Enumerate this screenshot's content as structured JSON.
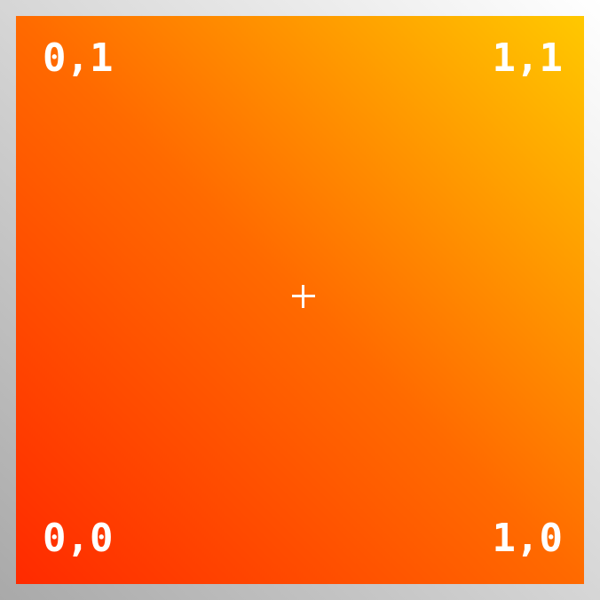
{
  "corners": {
    "top_left": "0,1",
    "top_right": "1,1",
    "bottom_left": "0,0",
    "bottom_right": "1,0"
  },
  "colors": {
    "background_start": "#a9a9a9",
    "background_end": "#ffffff",
    "gradient_start": "#ff2a00",
    "gradient_mid": "#ff6a00",
    "gradient_end": "#ffc800",
    "label_color": "#ffffff"
  },
  "center_marker": "crosshair-icon"
}
